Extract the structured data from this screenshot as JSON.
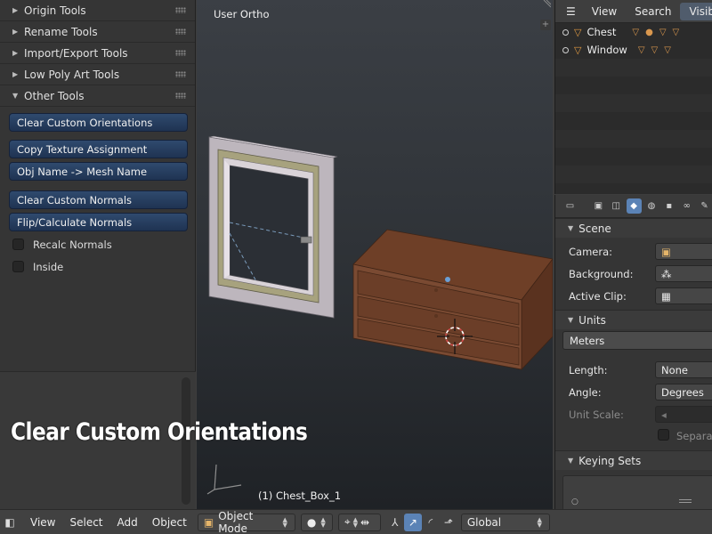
{
  "toolshelf": {
    "panels": [
      {
        "label": "Origin Tools",
        "expanded": false
      },
      {
        "label": "Rename Tools",
        "expanded": false
      },
      {
        "label": "Import/Export Tools",
        "expanded": false
      },
      {
        "label": "Low Poly Art Tools",
        "expanded": false
      },
      {
        "label": "Other Tools",
        "expanded": true
      }
    ],
    "buttons": {
      "clear_orientations": "Clear Custom Orientations",
      "copy_texture": "Copy Texture Assignment",
      "obj_to_mesh": "Obj Name -> Mesh Name",
      "clear_normals": "Clear Custom Normals",
      "flip_normals": "Flip/Calculate Normals"
    },
    "checkboxes": {
      "recalc": {
        "label": "Recalc Normals",
        "checked": false
      },
      "inside": {
        "label": "Inside",
        "checked": false
      }
    }
  },
  "overlay_caption": "Clear Custom Orientations",
  "viewport": {
    "view_label": "User Ortho",
    "object_label": "(1) Chest_Box_1"
  },
  "outliner": {
    "header": {
      "view": "View",
      "search": "Search",
      "visible": "Visib"
    },
    "rows": [
      {
        "name": "Chest"
      },
      {
        "name": "Window"
      }
    ]
  },
  "properties": {
    "scene_panel": {
      "title": "Scene",
      "camera_label": "Camera:",
      "background_label": "Background:",
      "active_clip_label": "Active Clip:"
    },
    "units_panel": {
      "title": "Units",
      "system": "Meters",
      "length_label": "Length:",
      "length_value": "None",
      "angle_label": "Angle:",
      "angle_value": "Degrees",
      "unit_scale_label": "Unit Scale:",
      "separate_label": "Separate"
    },
    "keying_panel": {
      "title": "Keying Sets"
    }
  },
  "bottombar": {
    "view": "View",
    "select": "Select",
    "add": "Add",
    "object": "Object",
    "mode": "Object Mode",
    "orientation": "Global"
  },
  "colors": {
    "accent_blue": "#5b83b6",
    "button_blue": "#2f4a6e",
    "chest_wood": "#7a4a32",
    "window_frame": "#bdb6bd"
  }
}
